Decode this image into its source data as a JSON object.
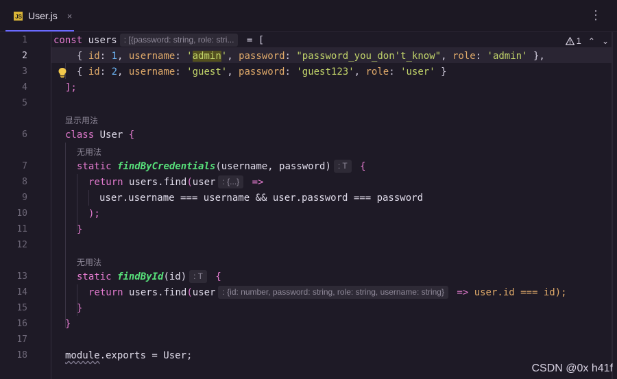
{
  "tab": {
    "icon_text": "JS",
    "title": "User.js",
    "close": "×"
  },
  "more_icon": "⋮",
  "inspection": {
    "warnings": "1",
    "up": "⌃",
    "down": "⌄"
  },
  "line_numbers": [
    "1",
    "2",
    "3",
    "4",
    "5",
    "6",
    "7",
    "8",
    "9",
    "10",
    "11",
    "12",
    "13",
    "14",
    "15",
    "16",
    "17",
    "18"
  ],
  "code_lens": {
    "class_user": "显示用法",
    "find_by_credentials": "无用法",
    "find_by_id": "无用法"
  },
  "hints": {
    "users_type": ": [{password: string, role: stri...",
    "return_type_1": ": T",
    "param_1": ": {...}",
    "return_type_2": ": T",
    "param_2": ": {id: number, password: string, role: string, username: string}"
  },
  "code": {
    "l1_kw": "const",
    "l1_var": "users",
    "l1_rest": " = [",
    "l2": {
      "id_val": "1",
      "username_val": "admin",
      "password_val": "\"password_you_don't_know\"",
      "role_val": "'admin'"
    },
    "l3": {
      "id_val": "2",
      "username_val": "'guest'",
      "password_val": "'guest123'",
      "role_val": "'user'"
    },
    "l4": "];",
    "l6_kw": "class",
    "l6_name": "User",
    "l6_rest": " {",
    "l7_kw": "static",
    "l7_fn": "findByCredentials",
    "l7_params": "(username, password)",
    "l8_kw": "return",
    "l8_obj": "users",
    "l8_fn": "find",
    "l8_param": "user",
    "l9": "user.username === username && user.password === password",
    "l10": ");",
    "l11": "}",
    "l13_kw": "static",
    "l13_fn": "findById",
    "l13_params": "(id)",
    "l14_kw": "return",
    "l14_obj": "users",
    "l14_fn": "find",
    "l14_param": "user",
    "l14_tail": "user.id === id);",
    "l15": "}",
    "l16": "}",
    "l18_mod": "module",
    "l18_rest": ".exports = ",
    "l18_cls": "User",
    "l18_end": ";"
  },
  "watermark": "CSDN @0x h41f"
}
